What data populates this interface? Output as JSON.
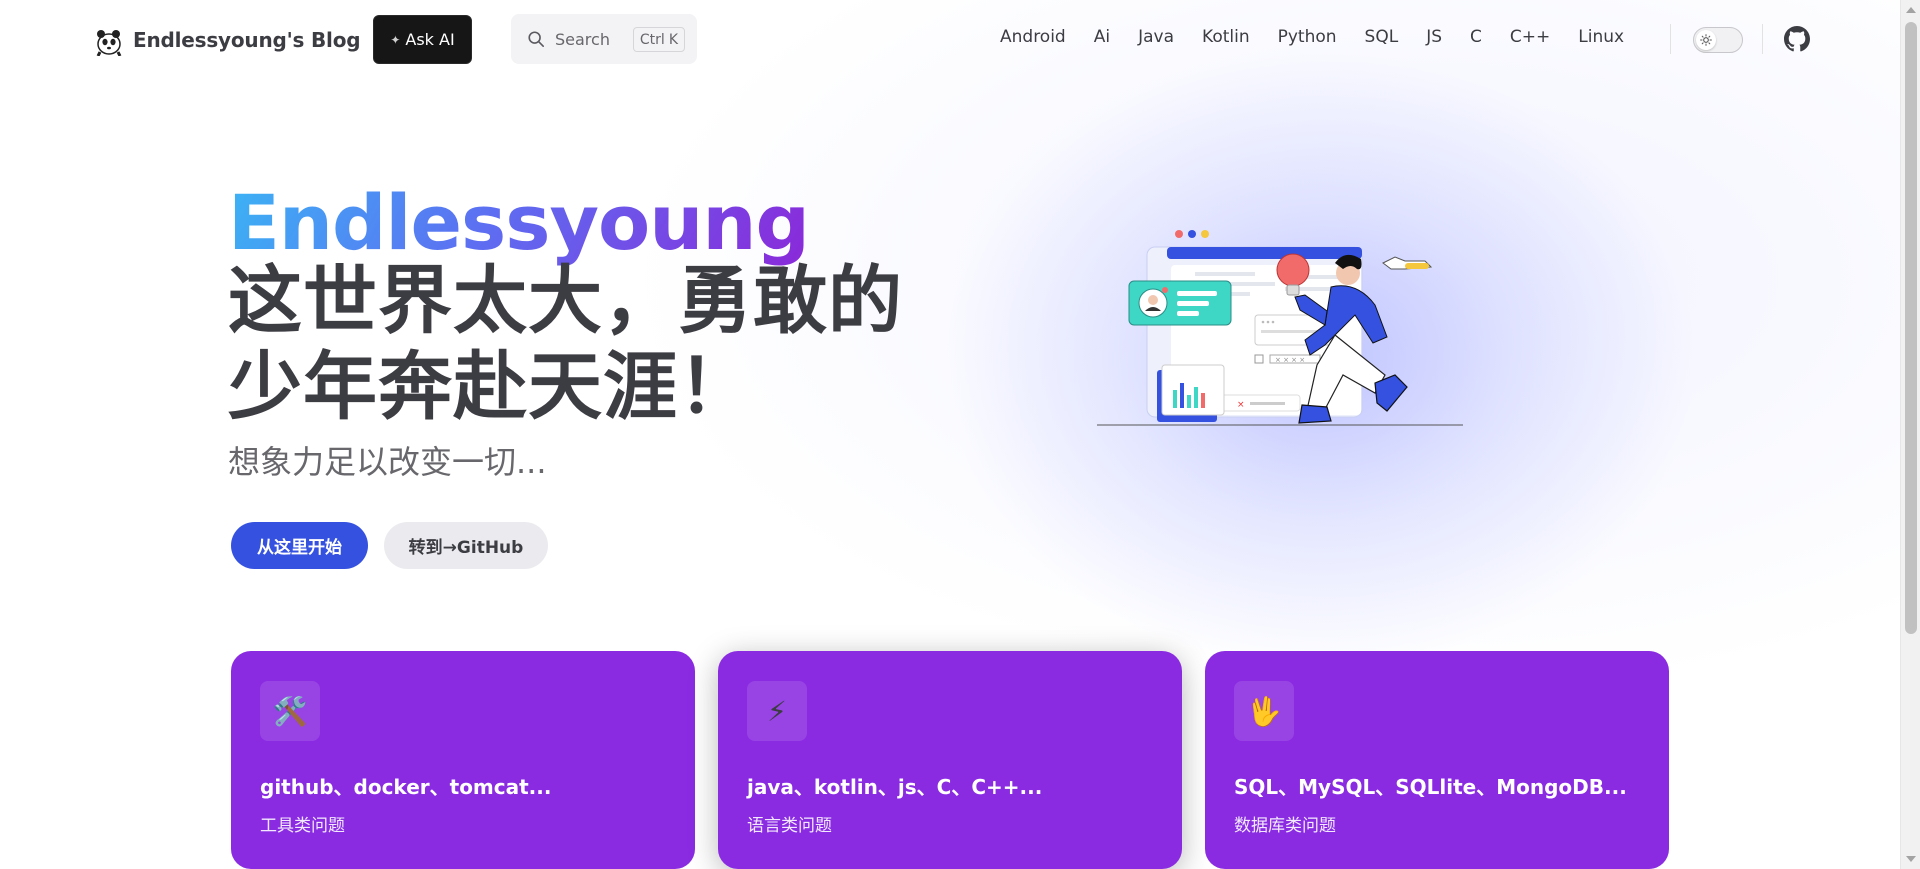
{
  "site": {
    "title": "Endlessyoung's Blog"
  },
  "ask_ai": {
    "label": "Ask AI"
  },
  "search": {
    "label": "Search",
    "kbd_mod": "Ctrl",
    "kbd_key": "K"
  },
  "nav": {
    "items": [
      {
        "label": "Android"
      },
      {
        "label": "Ai"
      },
      {
        "label": "Java"
      },
      {
        "label": "Kotlin"
      },
      {
        "label": "Python"
      },
      {
        "label": "SQL"
      },
      {
        "label": "JS"
      },
      {
        "label": "C"
      },
      {
        "label": "C++"
      },
      {
        "label": "Linux"
      }
    ]
  },
  "hero": {
    "name": "Endlessyoung",
    "text": "这世界太大，勇敢的少年奔赴天涯！",
    "tagline": "想象力足以改变一切...",
    "actions": [
      {
        "label": "从这里开始"
      },
      {
        "label": "转到→GitHub"
      }
    ]
  },
  "features": [
    {
      "icon": "🛠️",
      "title": "github、docker、tomcat...",
      "details": "工具类问题"
    },
    {
      "icon": "⚡",
      "title": "java、kotlin、js、C、C++...",
      "details": "语言类问题"
    },
    {
      "icon": "🖖",
      "title": "SQL、MySQL、SQLlite、MongoDB...",
      "details": "数据库类问题"
    }
  ],
  "colors": {
    "brand": "#3451e0",
    "card_bg": "#8a2be2",
    "name_gradient": [
      "#3bb4f5",
      "#5d6ef2",
      "#8b28d9"
    ]
  }
}
